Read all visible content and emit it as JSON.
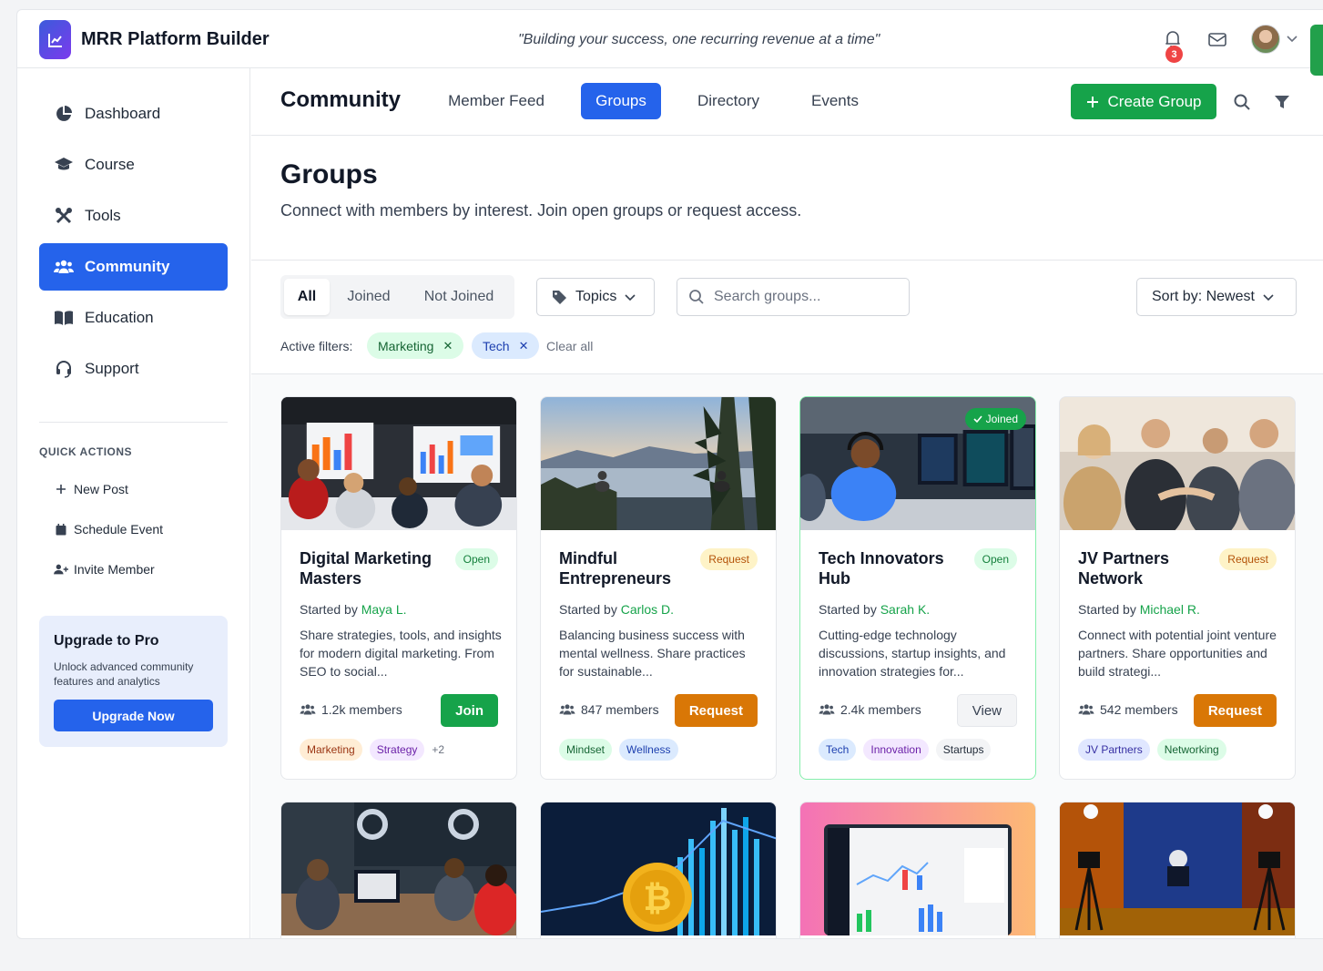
{
  "app": {
    "title": "MRR Platform Builder",
    "tagline": "\"Building your success, one recurring revenue at a time\"",
    "notification_count": "3"
  },
  "sidebar": {
    "items": [
      {
        "label": "Dashboard",
        "icon": "pie-chart-icon"
      },
      {
        "label": "Course",
        "icon": "graduation-cap-icon"
      },
      {
        "label": "Tools",
        "icon": "tools-icon"
      },
      {
        "label": "Community",
        "icon": "users-icon",
        "active": true
      },
      {
        "label": "Education",
        "icon": "book-icon"
      },
      {
        "label": "Support",
        "icon": "headset-icon"
      }
    ],
    "quick_actions_title": "QUICK ACTIONS",
    "quick_actions": [
      {
        "label": "New Post",
        "icon": "plus-icon"
      },
      {
        "label": "Schedule Event",
        "icon": "calendar-icon"
      },
      {
        "label": "Invite Member",
        "icon": "user-plus-icon"
      }
    ],
    "upgrade": {
      "title": "Upgrade to Pro",
      "description": "Unlock advanced community features and analytics",
      "button": "Upgrade Now"
    }
  },
  "subnav": {
    "title": "Community",
    "tabs": [
      {
        "label": "Member Feed"
      },
      {
        "label": "Groups",
        "active": true
      },
      {
        "label": "Directory"
      },
      {
        "label": "Events"
      }
    ],
    "create_button": "Create Group"
  },
  "page": {
    "title": "Groups",
    "description": "Connect with members by interest. Join open groups or request access."
  },
  "filters": {
    "segments": [
      "All",
      "Joined",
      "Not Joined"
    ],
    "active_segment": "All",
    "topics_label": "Topics",
    "search_placeholder": "Search groups...",
    "sort_label": "Sort by: Newest",
    "active_filters_label": "Active filters:",
    "chips": [
      "Marketing",
      "Tech"
    ],
    "clear_all": "Clear all"
  },
  "groups": [
    {
      "title": "Digital Marketing Masters",
      "status": "Open",
      "started_by": "Started by ",
      "founder": "Maya L.",
      "description": "Share strategies, tools, and insights for modern digital marketing. From SEO to social...",
      "members": "1.2k members",
      "action": "Join",
      "tags": [
        "Marketing",
        "Strategy"
      ],
      "more": "+2"
    },
    {
      "title": "Mindful Entrepreneurs",
      "status": "Request",
      "started_by": "Started by ",
      "founder": "Carlos D.",
      "description": "Balancing business success with mental wellness. Share practices for sustainable...",
      "members": "847 members",
      "action": "Request",
      "tags": [
        "Mindset",
        "Wellness"
      ]
    },
    {
      "title": "Tech Innovators Hub",
      "status": "Open",
      "joined_badge": "Joined",
      "started_by": "Started by ",
      "founder": "Sarah K.",
      "description": "Cutting-edge technology discussions, startup insights, and innovation strategies for...",
      "members": "2.4k members",
      "action": "View",
      "tags": [
        "Tech",
        "Innovation",
        "Startups"
      ]
    },
    {
      "title": "JV Partners Network",
      "status": "Request",
      "started_by": "Started by ",
      "founder": "Michael R.",
      "description": "Connect with potential joint venture partners. Share opportunities and build strategi...",
      "members": "542 members",
      "action": "Request",
      "tags": [
        "JV Partners",
        "Networking"
      ]
    }
  ],
  "colors": {
    "primary": "#2563eb",
    "success": "#16a34a",
    "warning": "#d97706",
    "danger": "#ef4444"
  }
}
